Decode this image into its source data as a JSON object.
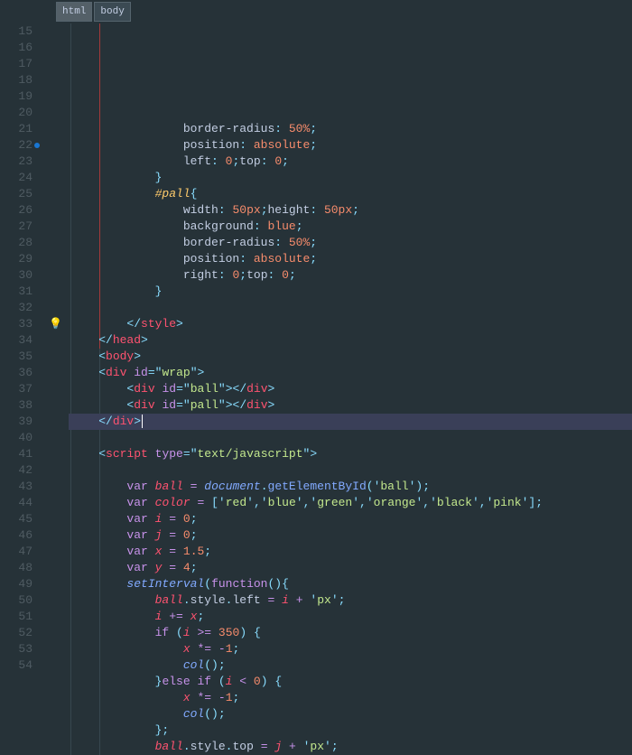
{
  "breadcrumb": {
    "items": [
      "html",
      "body"
    ]
  },
  "gutter": {
    "start": 15,
    "end": 54,
    "marker_line": 22,
    "bulb_line": 33,
    "highlight_line": 34
  },
  "guides": {
    "scope_start_line": 15,
    "scope_end_line": 34
  },
  "code": {
    "l15": {
      "prop": "border-radius",
      "val": "50%"
    },
    "l16": {
      "prop": "border-radius",
      "val": "50%"
    },
    "l17": {
      "prop": "position",
      "val": "absolute"
    },
    "l18": {
      "prop1": "left",
      "v1": "0",
      "prop2": "top",
      "v2": "0"
    },
    "l20": {
      "sel": "#pall"
    },
    "l21": {
      "p1": "width",
      "v1": "50px",
      "p2": "height",
      "v2": "50px"
    },
    "l22": {
      "prop": "background",
      "val": "blue"
    },
    "l23": {
      "prop": "border-radius",
      "val": "50%"
    },
    "l24": {
      "prop": "position",
      "val": "absolute"
    },
    "l25": {
      "prop1": "right",
      "v1": "0",
      "prop2": "top",
      "v2": "0"
    },
    "l28": {
      "tag": "style"
    },
    "l29": {
      "tag": "head"
    },
    "l30": {
      "tag": "body"
    },
    "l31": {
      "tag": "div",
      "attr": "id",
      "val": "wrap"
    },
    "l32": {
      "tag": "div",
      "attr": "id",
      "val": "ball"
    },
    "l33": {
      "tag": "div",
      "attr": "id",
      "val": "pall"
    },
    "l34": {
      "tag": "div"
    },
    "l36": {
      "tag": "script",
      "attr": "type",
      "val": "text/javascript"
    },
    "l38": {
      "kw": "var",
      "name": "ball",
      "obj": "document",
      "fn": "getElementById",
      "arg": "ball"
    },
    "l39": {
      "kw": "var",
      "name": "color",
      "arr": [
        "red",
        "blue",
        "green",
        "orange",
        "black",
        "pink"
      ]
    },
    "l40": {
      "kw": "var",
      "name": "i",
      "val": "0"
    },
    "l41": {
      "kw": "var",
      "name": "j",
      "val": "0"
    },
    "l42": {
      "kw": "var",
      "name": "x",
      "val": "1.5"
    },
    "l43": {
      "kw": "var",
      "name": "y",
      "val": "4"
    },
    "l44": {
      "fn": "setInterval",
      "kw": "function"
    },
    "l45": {
      "obj": "ball",
      "p1": "style",
      "p2": "left",
      "v": "i",
      "unit": "px"
    },
    "l46": {
      "v": "i",
      "op": "+=",
      "r": "x"
    },
    "l47": {
      "kw": "if",
      "v": "i",
      "op": ">=",
      "n": "350"
    },
    "l48": {
      "v": "x",
      "op": "*=",
      "n": "-1"
    },
    "l49": {
      "fn": "col"
    },
    "l50": {
      "kw": "else if",
      "v": "i",
      "op": "<",
      "n": "0"
    },
    "l51": {
      "v": "x",
      "op": "*=",
      "n": "-1"
    },
    "l52": {
      "fn": "col"
    },
    "l54": {
      "obj": "ball",
      "p1": "style",
      "p2": "top",
      "v": "j",
      "unit": "px"
    }
  }
}
